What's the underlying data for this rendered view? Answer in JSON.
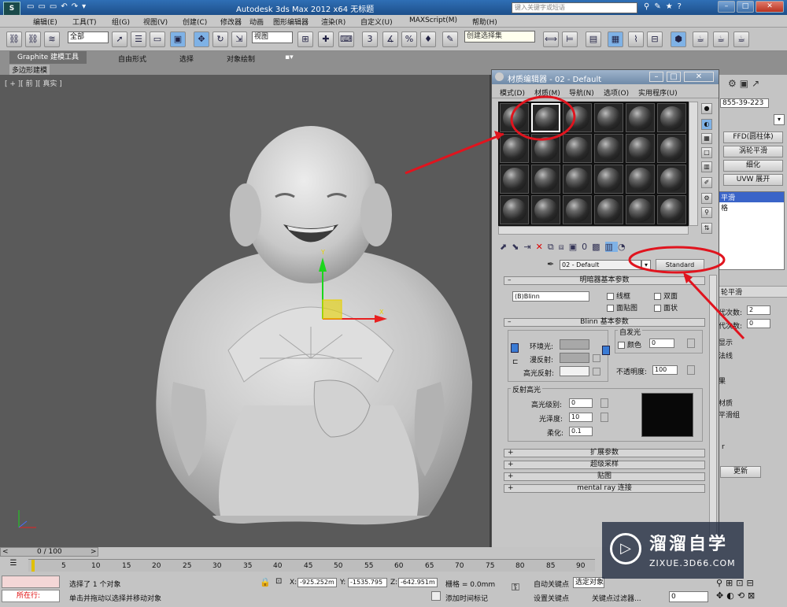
{
  "app": {
    "title": "Autodesk 3ds Max  2012 x64      无标题",
    "search_placeholder": "键入关键字或短语"
  },
  "menubar": [
    "编辑(E)",
    "工具(T)",
    "组(G)",
    "视图(V)",
    "创建(C)",
    "修改器",
    "动画",
    "图形编辑器",
    "渲染(R)",
    "自定义(U)",
    "MAXScript(M)",
    "帮助(H)"
  ],
  "toolbar": {
    "filter_select": "全部",
    "ref_coord": "视图",
    "named_sel": "创建选择集"
  },
  "ribbon": {
    "tabs": [
      "Graphite 建模工具",
      "自由形式",
      "选择",
      "对象绘制"
    ],
    "sub": "多边形建模"
  },
  "viewport": {
    "label": "[ + ][ 前 ][ 真实 ]"
  },
  "right_panel": {
    "object_name": "855-39-223",
    "buttons": [
      "FFD(圆柱体)",
      "涡轮平滑",
      "细化",
      "UVW 展开"
    ],
    "stack": [
      "平滑",
      "格"
    ],
    "section_title": "轮平滑",
    "iter_label": "代次数:",
    "iter_value": "2",
    "render_iter_label": "代次数:",
    "render_iter_value": "0",
    "show_label": "显示",
    "isoline": "法线",
    "more": [
      "果",
      "材质",
      "平滑组"
    ],
    "r_label": "r",
    "update": "更新"
  },
  "mat_editor": {
    "title": "材质编辑器 - 02 - Default",
    "menus": [
      "模式(D)",
      "材质(M)",
      "导航(N)",
      "选项(O)",
      "实用程序(U)"
    ],
    "material_name": "02 - Default",
    "type_button": "Standard",
    "shader_roll": "明暗器基本参数",
    "shader": "(B)Blinn",
    "opts": [
      "线框",
      "双面",
      "面贴图",
      "面状"
    ],
    "blinn_roll": "Blinn 基本参数",
    "self_illum": "自发光",
    "color_label": "颜色",
    "color_val": "0",
    "ambient": "环境光:",
    "diffuse": "漫反射:",
    "specular": "高光反射:",
    "opacity_label": "不透明度:",
    "opacity_val": "100",
    "spec_group": "反射高光",
    "spec_level": "高光级别:",
    "spec_level_val": "0",
    "gloss": "光泽度:",
    "gloss_val": "10",
    "soften": "柔化:",
    "soften_val": "0.1",
    "rollouts": [
      "扩展参数",
      "超级采样",
      "贴图",
      "mental ray 连接"
    ]
  },
  "timeline": {
    "frame": "0 / 100",
    "ticks": [
      "0",
      "5",
      "10",
      "15",
      "20",
      "25",
      "30",
      "35",
      "40",
      "45",
      "50",
      "55",
      "60",
      "65",
      "70",
      "75",
      "80",
      "85",
      "90"
    ],
    "status1": "选择了 1 个对象",
    "status2": "单击并拖动以选择并移动对象",
    "prompt": "所在行:",
    "x_label": "X:",
    "x_val": "-925.252m",
    "y_label": "Y:",
    "y_val": "-1535.795",
    "z_label": "Z:",
    "z_val": "-642.951m",
    "grid": "栅格 = 0.0mm",
    "auto_key": "自动关键点",
    "sel_obj": "选定对象",
    "set_key": "设置关键点",
    "key_filter": "关键点过滤器...",
    "add_time": "添加时间标记",
    "frame_box": "0"
  },
  "watermark": {
    "brand": "溜溜自学",
    "url": "ZIXUE.3D66.COM"
  },
  "colors": {
    "annotation": "#e0141e",
    "accent": "#2f6fb5"
  }
}
